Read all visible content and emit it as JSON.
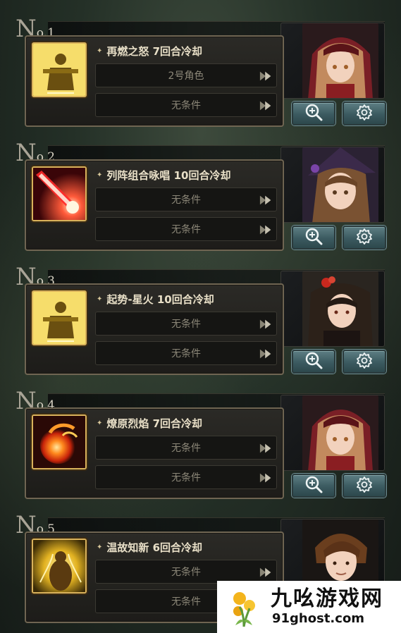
{
  "team": [
    {
      "no_prefix": "N",
      "no_suffix": "o.",
      "no_index": "1",
      "skill_title": "再燃之怒 7回合冷却",
      "conditions": [
        "2号角色",
        "无条件"
      ],
      "skill_icon": "golden-warrior-icon",
      "portrait": "red-hood-girl-portrait"
    },
    {
      "no_prefix": "N",
      "no_suffix": "o.",
      "no_index": "2",
      "skill_title": "列阵组合咏唱 10回合冷却",
      "conditions": [
        "无条件",
        "无条件"
      ],
      "skill_icon": "red-laser-burst-icon",
      "portrait": "witch-hat-girl-portrait"
    },
    {
      "no_prefix": "N",
      "no_suffix": "o.",
      "no_index": "3",
      "skill_title": "起势-星火 10回合冷却",
      "conditions": [
        "无条件",
        "无条件"
      ],
      "skill_icon": "golden-warrior-icon",
      "portrait": "dark-hair-flower-girl-portrait"
    },
    {
      "no_prefix": "N",
      "no_suffix": "o.",
      "no_index": "4",
      "skill_title": "燎原烈焰 7回合冷却",
      "conditions": [
        "无条件",
        "无条件"
      ],
      "skill_icon": "fireball-icon",
      "portrait": "red-hood-girl-portrait"
    },
    {
      "no_prefix": "N",
      "no_suffix": "o.",
      "no_index": "5",
      "skill_title": "温故知新 6回合冷却",
      "conditions": [
        "无条件",
        "无条件"
      ],
      "skill_icon": "golden-aura-mage-icon",
      "portrait": "brown-hair-man-portrait"
    }
  ],
  "buttons": {
    "zoom_icon": "magnify-plus-icon",
    "settings_icon": "gear-icon"
  },
  "watermark": {
    "title": "九吆游戏网",
    "url": "91ghost.com"
  },
  "colors": {
    "card_border": "#6f6552",
    "skill_text": "#e8dfc7",
    "condition_text": "#8c8778",
    "button_teal": "#4d6e73",
    "icon_frame_gold": "#d9b25b"
  }
}
